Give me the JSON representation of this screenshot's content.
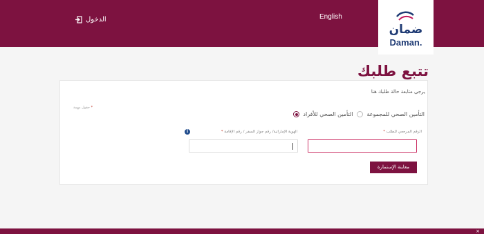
{
  "header": {
    "logo_arabic": "ضمان",
    "logo_latin": "Daman.",
    "language_link": "English",
    "login_label": "الدخول"
  },
  "page": {
    "title": "تتبع طلبك"
  },
  "form": {
    "subtitle": "يرجى متابعة حالة طلبك هنا",
    "required_note": "حقول مهمة",
    "required_star": "*",
    "radio_options": [
      {
        "label": "التأمين الصحي للأفراد",
        "checked": true
      },
      {
        "label": "التأمين الصحي للمجموعة",
        "checked": false
      }
    ],
    "reference_label": "الرقم المرجعي للطلب",
    "id_label": "الهوية الإماراتية/ رقم جواز السفر / رقم الإقامة",
    "reference_value": "",
    "id_value": "",
    "info_icon": "i",
    "preview_button": "معاينة الإستمارة"
  },
  "footer": {
    "close_glyph": "×"
  },
  "colors": {
    "brand": "#7d1240",
    "logo_blue": "#1f3b74",
    "info_blue": "#1f4b8c",
    "error_border": "#cc3366"
  },
  "icons": [
    "logo-icon",
    "login-icon",
    "info-icon",
    "close-icon"
  ]
}
